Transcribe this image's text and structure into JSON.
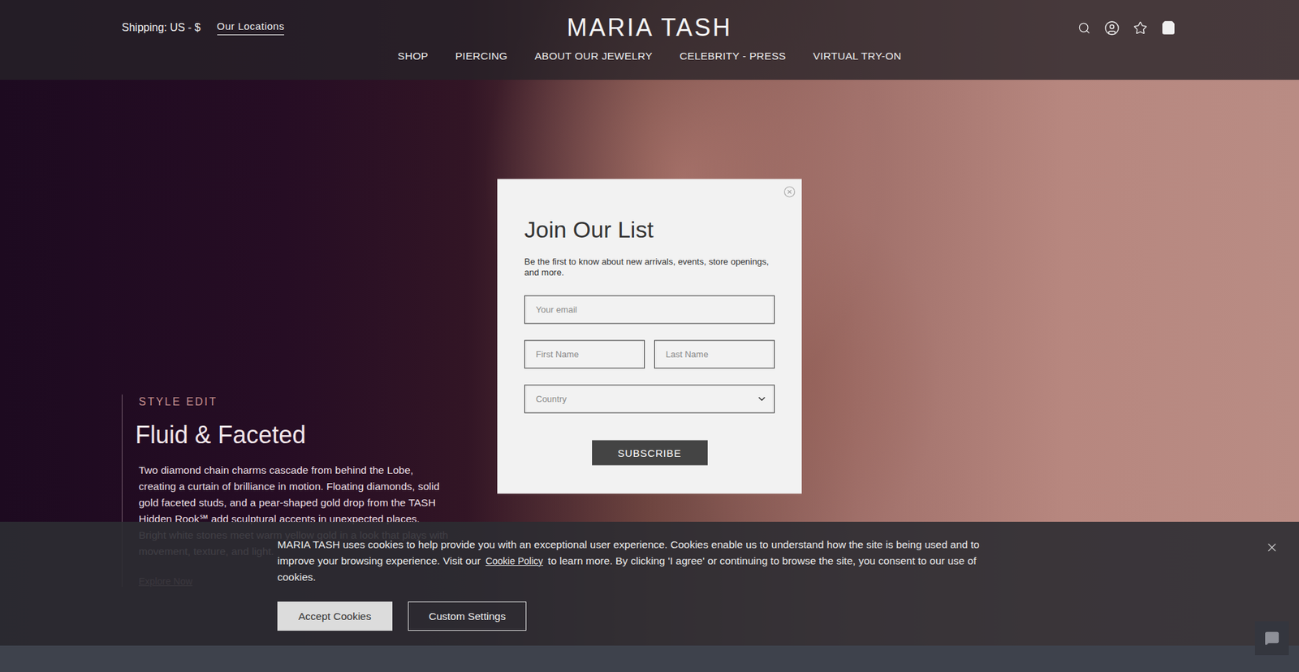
{
  "header": {
    "shipping": "Shipping: US - $",
    "locations": "Our Locations",
    "logo": "MARIA TASH"
  },
  "nav": [
    "SHOP",
    "PIERCING",
    "ABOUT OUR JEWELRY",
    "CELEBRITY - PRESS",
    "VIRTUAL TRY-ON"
  ],
  "hero": {
    "eyebrow": "STYLE EDIT",
    "title": "Fluid & Faceted",
    "body": "Two diamond chain charms cascade from behind the Lobe, creating a curtain of brilliance in motion. Floating diamonds, solid gold faceted studs, and a pear-shaped gold drop from the TASH Hidden Rook℠ add sculptural accents in unexpected places. Bright white stones meet warm yellow gold in a look that plays with movement, texture, and light.",
    "link": "Explore Now"
  },
  "modal": {
    "title": "Join Our List",
    "description": "Be the first to know about new arrivals, events, store openings, and more.",
    "email_placeholder": "Your email",
    "first_name_placeholder": "First Name",
    "last_name_placeholder": "Last Name",
    "country_placeholder": "Country",
    "button": "SUBSCRIBE"
  },
  "cookies": {
    "text_before": "MARIA TASH uses cookies to help provide you with an exceptional user experience. Cookies enable us to understand how the site is being used and to improve your browsing experience. Visit our ",
    "link": "Cookie Policy",
    "text_after": " to learn more. By clicking 'I agree' or continuing to browse the site, you consent to our use of cookies.",
    "buttons": [
      {
        "label": "Accept Cookies",
        "kind": "filled"
      },
      {
        "label": "Custom Settings",
        "kind": "outlined"
      }
    ]
  }
}
